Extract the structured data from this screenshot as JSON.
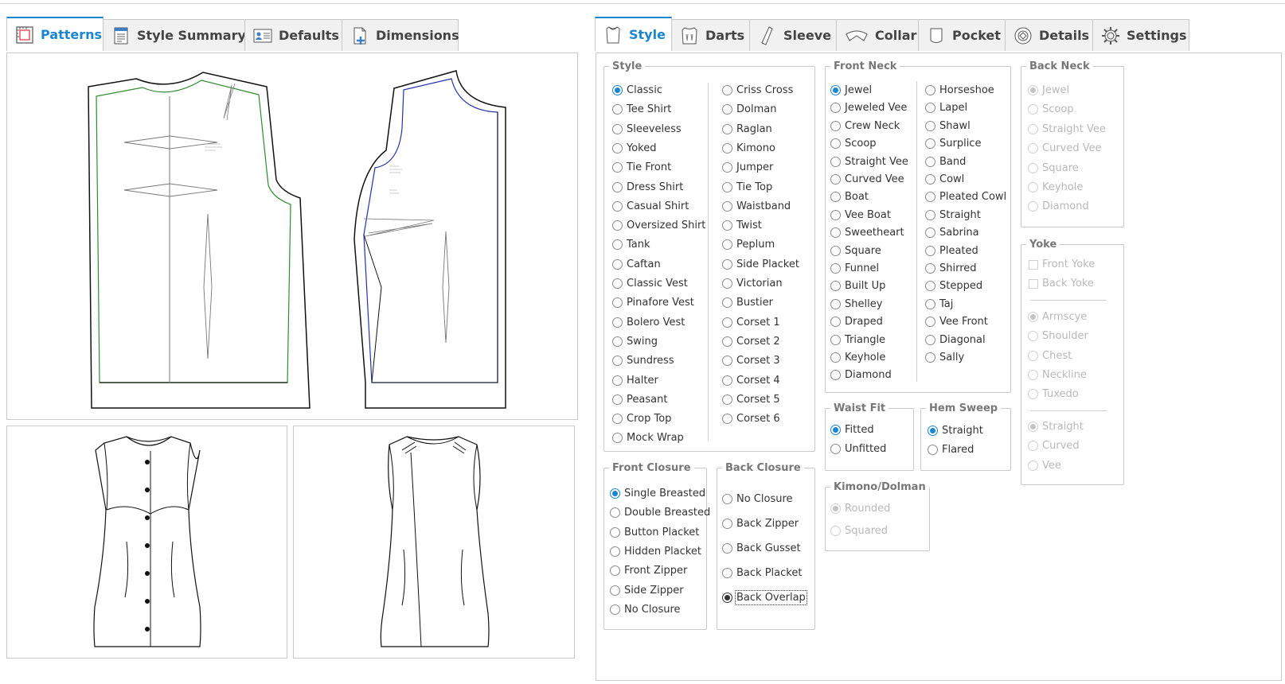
{
  "left_tabs": [
    {
      "label": "Patterns",
      "icon": "pattern-icon",
      "active": true
    },
    {
      "label": "Style Summary",
      "icon": "summary-icon",
      "active": false
    },
    {
      "label": "Defaults",
      "icon": "defaults-icon",
      "active": false
    },
    {
      "label": "Dimensions",
      "icon": "dimensions-icon",
      "active": false
    }
  ],
  "right_tabs": [
    {
      "label": "Style",
      "icon": "bodice-icon",
      "active": true
    },
    {
      "label": "Darts",
      "icon": "darts-icon",
      "active": false
    },
    {
      "label": "Sleeve",
      "icon": "sleeve-icon",
      "active": false
    },
    {
      "label": "Collar",
      "icon": "collar-icon",
      "active": false
    },
    {
      "label": "Pocket",
      "icon": "pocket-icon",
      "active": false
    },
    {
      "label": "Details",
      "icon": "details-icon",
      "active": false
    },
    {
      "label": "Settings",
      "icon": "gear-icon",
      "active": false
    }
  ],
  "style": {
    "legend": "Style",
    "col1": [
      "Classic",
      "Tee Shirt",
      "Sleeveless",
      "Yoked",
      "Tie Front",
      "Dress Shirt",
      "Casual Shirt",
      "Oversized Shirt",
      "Tank",
      "Caftan",
      "Classic Vest",
      "Pinafore Vest",
      "Bolero Vest",
      "Swing",
      "Sundress",
      "Halter",
      "Peasant",
      "Crop Top",
      "Mock Wrap"
    ],
    "col2": [
      "Criss Cross",
      "Dolman",
      "Raglan",
      "Kimono",
      "Jumper",
      "Tie Top",
      "Waistband",
      "Twist",
      "Peplum",
      "Side Placket",
      "Victorian",
      "Bustier",
      "Corset 1",
      "Corset 2",
      "Corset 3",
      "Corset 4",
      "Corset 5",
      "Corset 6"
    ],
    "selected": "Classic"
  },
  "front_neck": {
    "legend": "Front Neck",
    "col1": [
      "Jewel",
      "Jeweled Vee",
      "Crew Neck",
      "Scoop",
      "Straight Vee",
      "Curved Vee",
      "Boat",
      "Vee Boat",
      "Sweetheart",
      "Square",
      "Funnel",
      "Built Up",
      "Shelley",
      "Draped",
      "Triangle",
      "Keyhole",
      "Diamond"
    ],
    "col2": [
      "Horseshoe",
      "Lapel",
      "Shawl",
      "Surplice",
      "Band",
      "Cowl",
      "Pleated Cowl",
      "Straight",
      "Sabrina",
      "Pleated",
      "Shirred",
      "Stepped",
      "Taj",
      "Vee Front",
      "Diagonal",
      "Sally"
    ],
    "selected": "Jewel"
  },
  "back_neck": {
    "legend": "Back Neck",
    "options": [
      "Jewel",
      "Scoop",
      "Straight Vee",
      "Curved Vee",
      "Square",
      "Keyhole",
      "Diamond"
    ],
    "selected": "Jewel"
  },
  "yoke": {
    "legend": "Yoke",
    "checks": [
      "Front Yoke",
      "Back Yoke"
    ],
    "group1": [
      "Armscye",
      "Shoulder",
      "Chest",
      "Neckline",
      "Tuxedo"
    ],
    "group1_selected": "Armscye",
    "group2": [
      "Straight",
      "Curved",
      "Vee"
    ],
    "group2_selected": "Straight"
  },
  "waist_fit": {
    "legend": "Waist Fit",
    "options": [
      "Fitted",
      "Unfitted"
    ],
    "selected": "Fitted"
  },
  "hem_sweep": {
    "legend": "Hem Sweep",
    "options": [
      "Straight",
      "Flared"
    ],
    "selected": "Straight"
  },
  "kimono": {
    "legend": "Kimono/Dolman",
    "options": [
      "Rounded",
      "Squared"
    ],
    "selected": "Rounded"
  },
  "front_closure": {
    "legend": "Front Closure",
    "options": [
      "Single Breasted",
      "Double Breasted",
      "Button Placket",
      "Hidden Placket",
      "Front Zipper",
      "Side Zipper",
      "No Closure"
    ],
    "selected": "Single Breasted"
  },
  "back_closure": {
    "legend": "Back Closure",
    "options": [
      "No Closure",
      "Back Zipper",
      "Back Gusset",
      "Back Placket",
      "Back Overlap"
    ],
    "selected": "Back Overlap"
  },
  "colors": {
    "accent": "#1a86d0",
    "front_stitch": "#2e8b2e",
    "back_stitch": "#2233aa"
  }
}
